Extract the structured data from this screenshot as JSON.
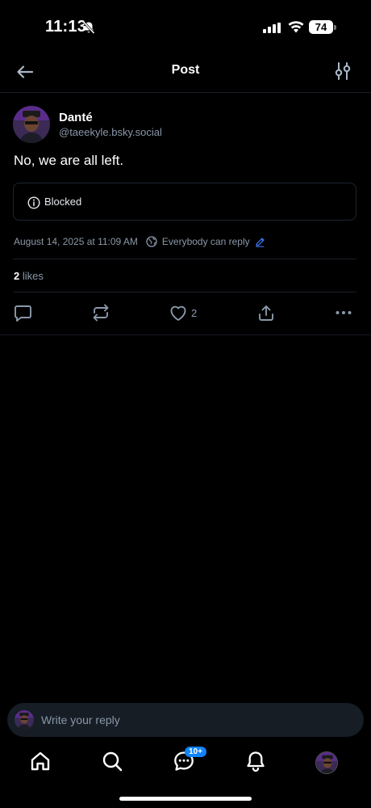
{
  "status_bar": {
    "time": "11:13",
    "battery": "74"
  },
  "header": {
    "title": "Post",
    "back_icon": "arrow-left-icon",
    "filter_icon": "sliders-icon"
  },
  "post": {
    "author": {
      "name": "Danté",
      "handle": "@taeekyle.bsky.social"
    },
    "text": "No, we are all left.",
    "embed": {
      "label": "Blocked"
    },
    "timestamp": "August 14, 2025 at 11:09 AM",
    "reply_setting": "Everybody can reply",
    "likes_count": "2",
    "likes_label": "likes",
    "like_action_count": "2"
  },
  "composer": {
    "placeholder": "Write your reply"
  },
  "tabbar": {
    "messages_badge": "10+"
  },
  "colors": {
    "background": "#000000",
    "muted_text": "#8b98a9",
    "accent": "#1083fe",
    "composer_bg": "#161d25"
  }
}
